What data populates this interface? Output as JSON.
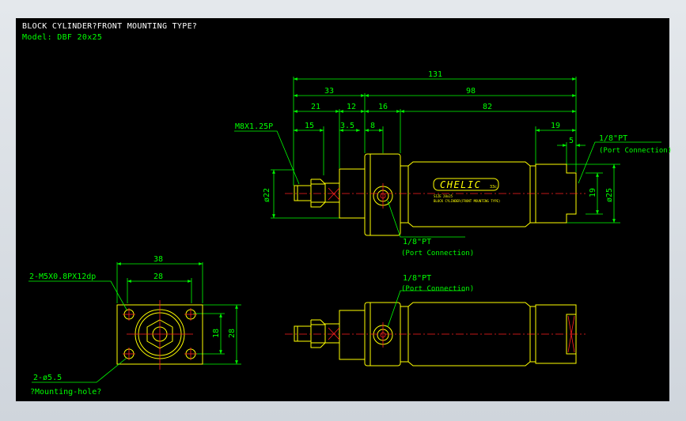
{
  "title": {
    "line1": "BLOCK CYLINDER?FRONT MOUNTING TYPE?",
    "model_label": "Model:",
    "model_value": "DBF 20x25"
  },
  "side_view": {
    "dims": {
      "total": "131",
      "front": "33",
      "body": "98",
      "d21": "21",
      "d12": "12",
      "d16": "16",
      "d82": "82",
      "d15": "15",
      "d35": "3.5",
      "d8": "8",
      "d19": "19",
      "d5": "5",
      "dia22": "ø22",
      "h19": "19",
      "dia25": "ø25"
    },
    "thread_label": "M8X1.25P",
    "rear_port_label": "1/8\"PT",
    "rear_port_note": "(Port Connection)",
    "front_port_label": "1/8\"PT",
    "front_port_note": "(Port Connection)",
    "brand_logo": "CHELIC",
    "brand_suffix": "33c",
    "body_text_1": "SIZE 20x25",
    "body_text_2": "BLOCK CYLINDER(FRONT MOUNTING TYPE)"
  },
  "end_view": {
    "dims": {
      "w38": "38",
      "w28": "28",
      "h18": "18",
      "h28": "28"
    },
    "tap_label": "2-M5X0.8PX12dp",
    "hole_label": "2-ø5.5",
    "hole_note": "?Mounting-hole?"
  },
  "bottom_view": {
    "port_label": "1/8\"PT",
    "port_note": "(Port Connection)"
  },
  "colors": {
    "background": "#000000",
    "outline": "#ffff00",
    "dimension": "#00ff00",
    "centerline": "#ff2020",
    "title": "#ffffff"
  }
}
